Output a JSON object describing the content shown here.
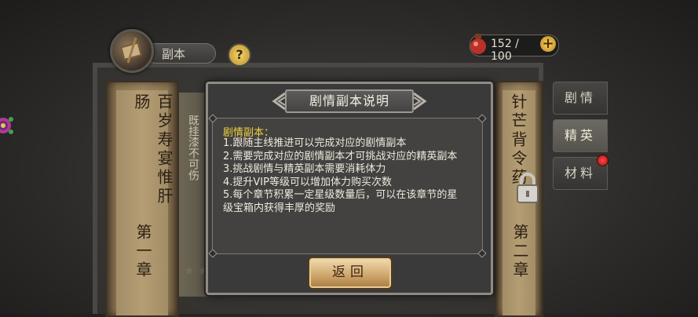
{
  "header": {
    "title": "副本",
    "help_label": "?",
    "stamina": "152 / 100",
    "plus_label": "+"
  },
  "side_tabs": [
    {
      "label": "剧情"
    },
    {
      "label": "精英"
    },
    {
      "label": "材料"
    }
  ],
  "chapters": {
    "left": {
      "name": "百岁寿宴惟肝肠",
      "chapter": "第一章"
    },
    "middle": {
      "text": "既挂漆不可伤"
    },
    "right": {
      "name": "针芒背令药",
      "chapter": "第二章"
    }
  },
  "dialog": {
    "title": "剧情副本说明",
    "heading": "剧情副本：",
    "lines": [
      "1.跟随主线推进可以完成对应的剧情副本",
      "2.需要完成对应的剧情副本才可挑战对应的精英副本",
      "3.挑战剧情与精英副本需要消耗体力",
      "4.提升VIP等级可以增加体力购买次数",
      "5.每个章节积累一定星级数量后，可以在该章节的星",
      "级宝箱内获得丰厚的奖励"
    ],
    "back_label": "返回"
  }
}
